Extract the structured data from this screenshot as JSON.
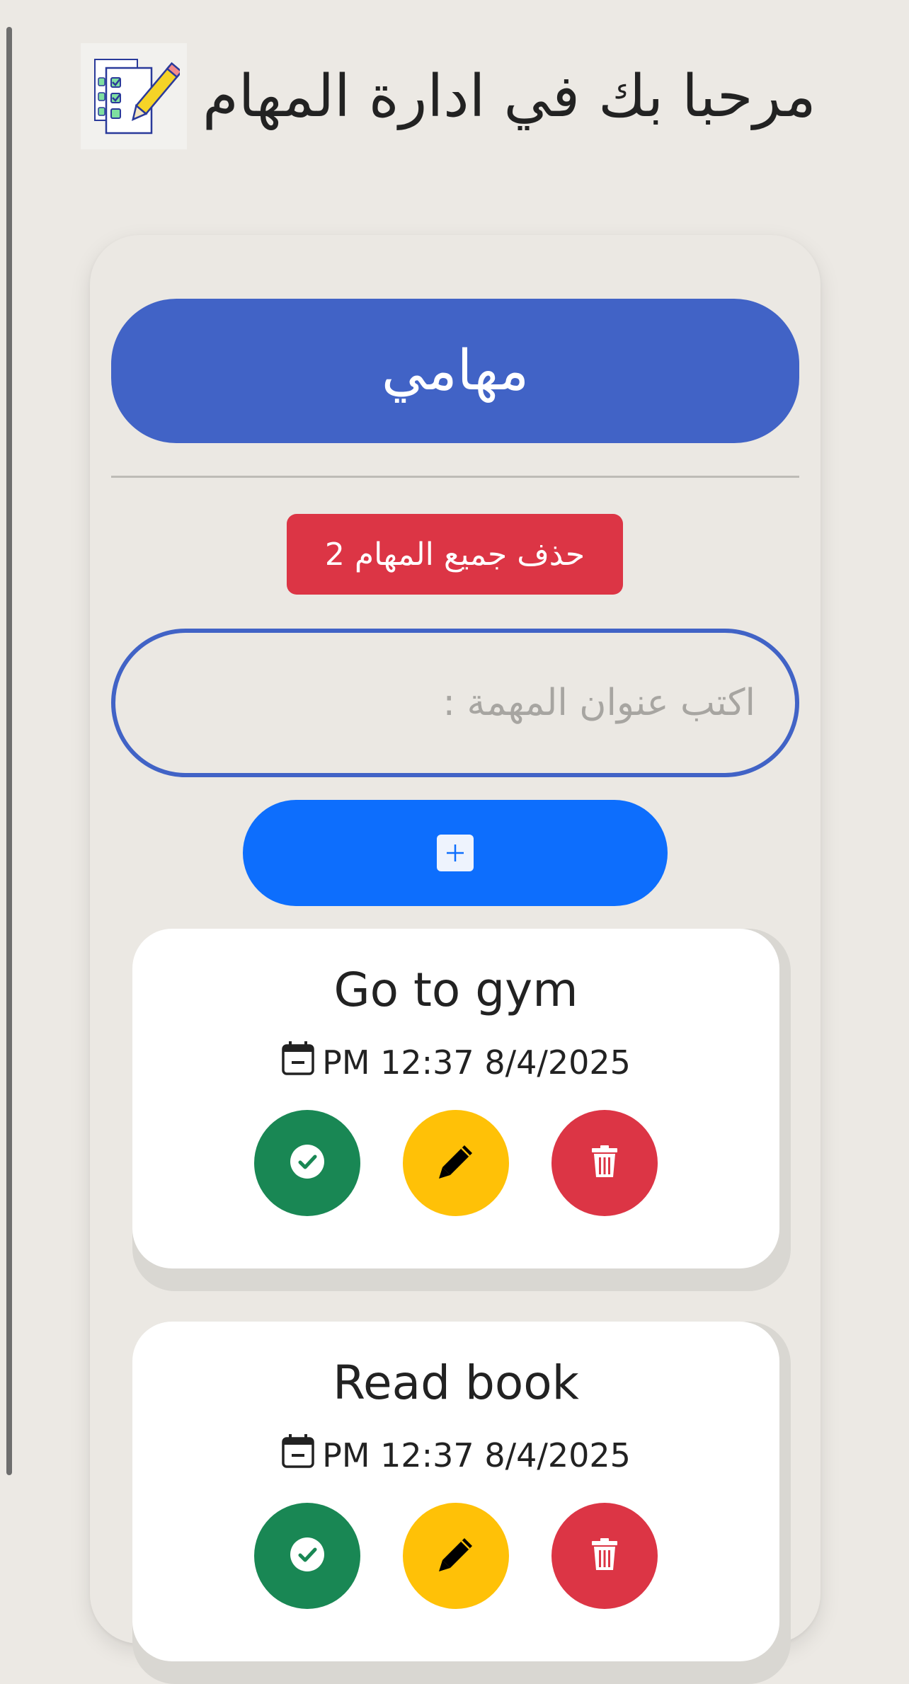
{
  "header": {
    "title": "مرحبا بك في ادارة المهام"
  },
  "main": {
    "tasks_heading": "مهامي",
    "delete_all_label": "حذف جميع المهام 2",
    "input_placeholder": "اكتب عنوان المهمة :"
  },
  "tasks": [
    {
      "title": "Go to gym",
      "date": "PM 12:37 8/4/2025"
    },
    {
      "title": "Read book",
      "date": "PM 12:37 8/4/2025"
    }
  ],
  "colors": {
    "primary": "#4163c6",
    "add": "#0d6efd",
    "done": "#198754",
    "edit": "#ffc107",
    "danger": "#dc3545",
    "background": "#ece9e4"
  },
  "icons": [
    "tasks-logo-icon",
    "plus-icon",
    "calendar-icon",
    "check-circle-icon",
    "pencil-icon",
    "trash-icon"
  ]
}
